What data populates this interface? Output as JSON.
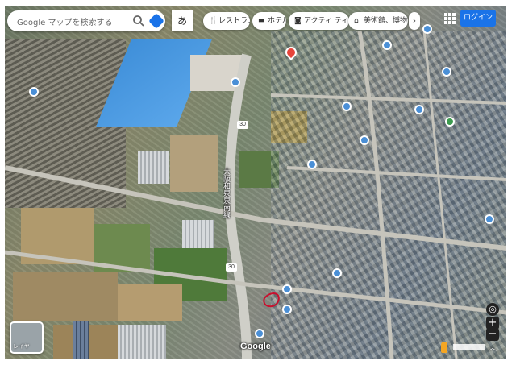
{
  "search": {
    "placeholder": "Google マップを検索する",
    "ime_mode": "あ"
  },
  "categories": [
    {
      "label": "レストラン",
      "icon": "fork-knife-icon"
    },
    {
      "label": "ホテル",
      "icon": "bed-icon"
    },
    {
      "label": "アクティ ティ",
      "icon": "camera-icon"
    },
    {
      "label": "美術館、博物館",
      "icon": "museum-icon"
    }
  ],
  "chevron": "›",
  "account": {
    "login_label": "ログイン"
  },
  "map": {
    "route_number": "30",
    "road_name": "大阪和泉泉南線",
    "layer_label": "レイヤ",
    "google_logo": "Google"
  },
  "controls": {
    "zoom_in": "+",
    "zoom_out": "−",
    "locate": "◎"
  },
  "colors": {
    "accent": "#1a73e8",
    "poi_blue": "#4a8fd6",
    "poi_green": "#3c9a4e",
    "pin_red": "#e6443a"
  }
}
